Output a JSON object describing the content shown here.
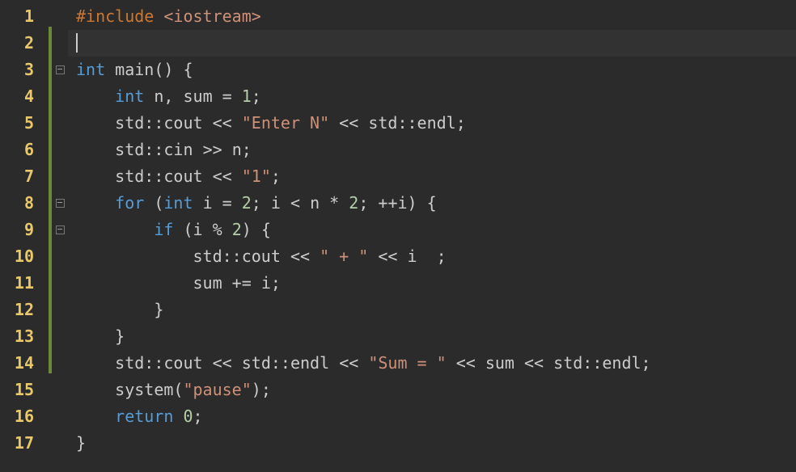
{
  "editor": {
    "language": "cpp",
    "cursor_line": 2,
    "lines": [
      {
        "num": 1,
        "changed": false,
        "fold": null
      },
      {
        "num": 2,
        "changed": true,
        "fold": null
      },
      {
        "num": 3,
        "changed": true,
        "fold": "open"
      },
      {
        "num": 4,
        "changed": true,
        "fold": null
      },
      {
        "num": 5,
        "changed": true,
        "fold": null
      },
      {
        "num": 6,
        "changed": true,
        "fold": null
      },
      {
        "num": 7,
        "changed": true,
        "fold": null
      },
      {
        "num": 8,
        "changed": true,
        "fold": "open"
      },
      {
        "num": 9,
        "changed": true,
        "fold": "open"
      },
      {
        "num": 10,
        "changed": true,
        "fold": null
      },
      {
        "num": 11,
        "changed": true,
        "fold": null
      },
      {
        "num": 12,
        "changed": true,
        "fold": null
      },
      {
        "num": 13,
        "changed": true,
        "fold": null
      },
      {
        "num": 14,
        "changed": true,
        "fold": null
      },
      {
        "num": 15,
        "changed": false,
        "fold": null
      },
      {
        "num": 16,
        "changed": false,
        "fold": null
      },
      {
        "num": 17,
        "changed": false,
        "fold": null
      }
    ],
    "code": {
      "l1": {
        "include": "#include",
        "header": "<iostream>"
      },
      "l3": {
        "kw_int": "int",
        "main": "main",
        "parens": "()",
        "brace": "{"
      },
      "l4": {
        "kw_int": "int",
        "n": "n",
        "comma": ",",
        "sum": "sum",
        "eq": "=",
        "one": "1",
        "semi": ";"
      },
      "l5": {
        "std": "std",
        "sep": "::",
        "cout": "cout",
        "lt": "<<",
        "str": "\"Enter N\"",
        "lt2": "<<",
        "std2": "std",
        "sep2": "::",
        "endl": "endl",
        "semi": ";"
      },
      "l6": {
        "std": "std",
        "sep": "::",
        "cin": "cin",
        "gt": ">>",
        "n": "n",
        "semi": ";"
      },
      "l7": {
        "std": "std",
        "sep": "::",
        "cout": "cout",
        "lt": "<<",
        "str": "\"1\"",
        "semi": ";"
      },
      "l8": {
        "kw_for": "for",
        "lp": "(",
        "kw_int": "int",
        "i": "i",
        "eq": "=",
        "two": "2",
        "semi1": ";",
        "i2": "i",
        "lt": "<",
        "n": "n",
        "mul": "*",
        "two2": "2",
        "semi2": ";",
        "inc": "++",
        "i3": "i",
        "rp": ")",
        "brace": "{"
      },
      "l9": {
        "kw_if": "if",
        "lp": "(",
        "i": "i",
        "mod": "%",
        "two": "2",
        "rp": ")",
        "brace": "{"
      },
      "l10": {
        "std": "std",
        "sep": "::",
        "cout": "cout",
        "lt": "<<",
        "str": "\" + \"",
        "lt2": "<<",
        "i": "i",
        "semi": ";"
      },
      "l11": {
        "sum": "sum",
        "op": "+=",
        "i": "i",
        "semi": ";"
      },
      "l12": {
        "brace": "}"
      },
      "l13": {
        "brace": "}"
      },
      "l14": {
        "std": "std",
        "sep": "::",
        "cout": "cout",
        "lt": "<<",
        "std2": "std",
        "sep2": "::",
        "endl": "endl",
        "lt2": "<<",
        "str": "\"Sum = \"",
        "lt3": "<<",
        "sum": "sum",
        "lt4": "<<",
        "std3": "std",
        "sep3": "::",
        "endl2": "endl",
        "semi": ";"
      },
      "l15": {
        "system": "system",
        "lp": "(",
        "str": "\"pause\"",
        "rp": ")",
        "semi": ";"
      },
      "l16": {
        "kw_return": "return",
        "zero": "0",
        "semi": ";"
      },
      "l17": {
        "brace": "}"
      }
    }
  },
  "fold_symbol": "−"
}
